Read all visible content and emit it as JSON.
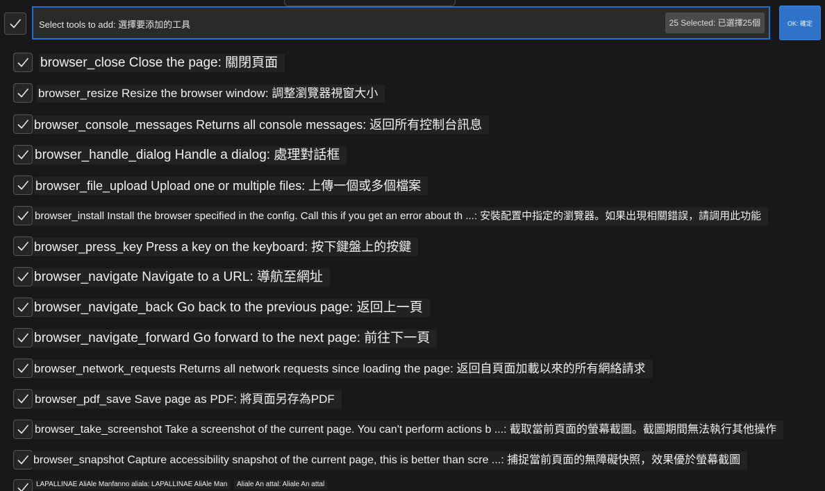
{
  "header": {
    "input_value": "Select tools to add: 選擇要添加的工具",
    "selected_count": "25 Selected: 已選擇25個",
    "ok_label": "OK: 確定"
  },
  "tools": [
    {
      "label": "browser_close Close the page: 關閉頁面"
    },
    {
      "label": "browser_resize Resize the browser window: 調整瀏覽器視窗大小"
    },
    {
      "label": "browser_console_messages Returns all console messages: 返回所有控制台訊息"
    },
    {
      "label": "browser_handle_dialog Handle a dialog: 處理對話框"
    },
    {
      "label": "browser_file_upload Upload one or multiple files: 上傳一個或多個檔案"
    },
    {
      "label": "browser_install Install the browser specified in the config. Call this if you get an error about th ...: 安裝配置中指定的瀏覽器。如果出現相關錯誤，請調用此功能"
    },
    {
      "label": "browser_press_key Press a key on the keyboard: 按下鍵盤上的按鍵"
    },
    {
      "label": "browser_navigate Navigate to a URL: 導航至網址"
    },
    {
      "label": "browser_navigate_back Go back to the previous page: 返回上一頁"
    },
    {
      "label": "browser_navigate_forward Go forward to the next page: 前往下一頁"
    },
    {
      "label": "browser_network_requests Returns all network requests since loading the page: 返回自頁面加載以來的所有網絡請求"
    },
    {
      "label": "browser_pdf_save Save page as PDF: 將頁面另存為PDF"
    },
    {
      "label": "browser_take_screenshot Take a screenshot of the current page. You can't perform actions b ...: 截取當前頁面的螢幕截圖。截圖期間無法執行其他操作"
    },
    {
      "label": "browser_snapshot Capture accessibility snapshot of the current page, this is better than scre ...: 捕捉當前頁面的無障礙快照，效果優於螢幕截圖"
    }
  ],
  "cutoff_row": {
    "part1": "LAPALLINAE AliAle Manfanno aliala: LAPALLINAE AliAle Man",
    "part2": "Aliale An attal: Aliale An attal"
  }
}
